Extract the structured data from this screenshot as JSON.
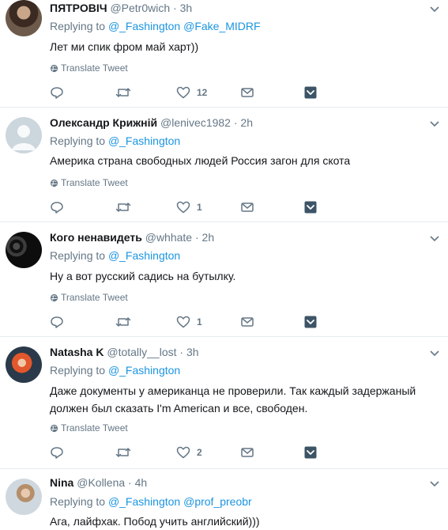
{
  "colors": {
    "link": "#1b95e0",
    "muted": "#657786",
    "text": "#14171a",
    "divider": "#e6ecf0"
  },
  "tweets": [
    {
      "name": "ПЯТРОВІЧ",
      "handle": "@Petr0wich",
      "time": "3h",
      "replying_prefix": "Replying to",
      "mentions": [
        "@_Fashington",
        "@Fake_MIDRF"
      ],
      "text": "Лет ми спик фром май харт))",
      "translate": "Translate Tweet",
      "likes": "12",
      "avatar_icon": "person-photo"
    },
    {
      "name": "Олександр Крижній",
      "handle": "@lenivec1982",
      "time": "2h",
      "replying_prefix": "Replying to",
      "mentions": [
        "@_Fashington"
      ],
      "text": "Америка страна свободных людей Россия загон для скота",
      "translate": "Translate Tweet",
      "likes": "1",
      "avatar_icon": "default-egg-avatar"
    },
    {
      "name": "Кого ненавидеть",
      "handle": "@whhate",
      "time": "2h",
      "replying_prefix": "Replying to",
      "mentions": [
        "@_Fashington"
      ],
      "text": "Ну а вот русский садись на бутылку.",
      "translate": "Translate Tweet",
      "likes": "1",
      "avatar_icon": "group-photo"
    },
    {
      "name": "Natasha K",
      "handle": "@totally__lost",
      "time": "3h",
      "replying_prefix": "Replying to",
      "mentions": [
        "@_Fashington"
      ],
      "text": "Даже документы у американца не проверили. Так каждый задержаный должен был сказать I'm American и все, свободен.",
      "translate": "Translate Tweet",
      "likes": "2",
      "avatar_icon": "fire-portrait-photo"
    },
    {
      "name": "Nina",
      "handle": "@Kollena",
      "time": "4h",
      "replying_prefix": "Replying to",
      "mentions": [
        "@_Fashington",
        "@prof_preobr"
      ],
      "text": "Ага, лайфхак. Побод учить английский)))",
      "translate": "",
      "likes": "",
      "avatar_icon": "outdoor-portrait-photo"
    }
  ]
}
